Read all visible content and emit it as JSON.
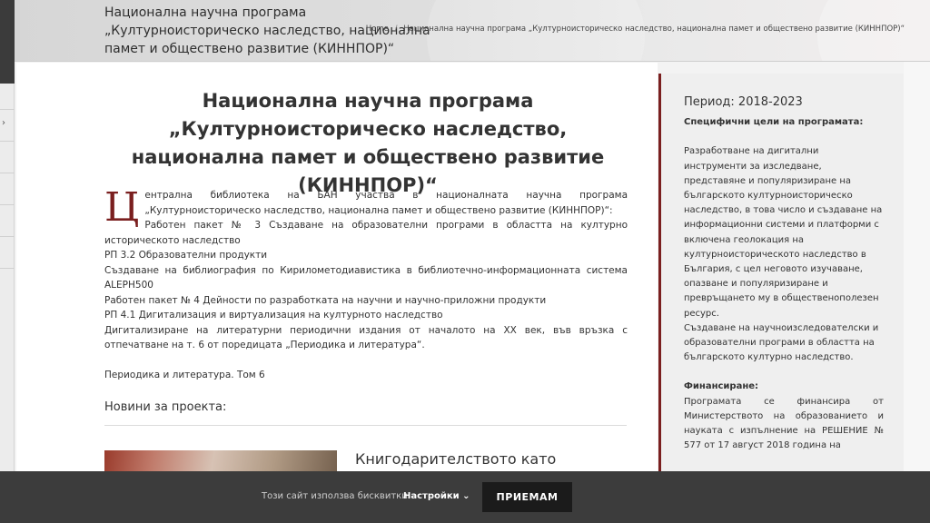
{
  "header": {
    "title": "Национална научна програма „Културноисторическо наследство, национална памет и обществено развитие (КИННПОР)“",
    "breadcrumb": {
      "home": "Home",
      "separator": "/",
      "current": "Национална научна програма „Културноисторическо наследство, национална памет и обществено развитие (КИННПОР)“"
    }
  },
  "left_strip": {
    "chevron_icon": "chevron-right-icon",
    "chevron_glyph": "›"
  },
  "article": {
    "title": "Национална научна програма „Културноисторическо наследство, национална памет и обществено развитие (КИННПОР)“",
    "dropcap": "Ц",
    "intro": "ентрална библиотека на БАН участва в националната научна програма „Културноисторическо наследство, национална памет и обществено развитие (КИННПОР)“:",
    "paragraphs": [
      "Работен пакет № 3 Създаване на образователни програми в областта на културно историческото наследство",
      "РП 3.2 Образователни продукти",
      "Създаване на библиография по Кирилометодиавистика в библиотечно-информационната система ALEPH500",
      "Работен пакет № 4 Дейности по разработката на научни и научно-приложни продукти",
      "РП 4.1 Дигитализация и виртуализация на културното наследство",
      "Дигитализиране на литературни периодични издания от началото на ХХ век, във връзка с отпечатване на т. 6 от поредицата „Периодика и литература“."
    ],
    "link": "Периодика и литература. Том 6"
  },
  "news": {
    "title": "Новини за проекта:",
    "item_title": "Книгодарителството като"
  },
  "sidebar": {
    "period": "Период: 2018-2023",
    "goals_heading": "Специфични цели на програмата:",
    "goals_text_1": "Разработване на дигитални инструменти за изследване, представяне и популяризиране на българското културноисторическо наследство, в това число и създаване на информационни системи и платформи с включена геолокация на културноисторическото наследство в България, с цел неговото изучаване, опазване и популяризиране и превръщането му в общественополезен ресурс.",
    "goals_text_2": "Създаване на научноизследователски и образователни програми в областта на българското културно наследство.",
    "funding_heading": "Финансиране:",
    "funding_text": "Програмата се финансира от Министерството на образованието и науката с изпълнение на РЕШЕНИЕ № 577 от 17 август 2018 година на"
  },
  "cookie": {
    "text": "Този сайт използва бисквитки!",
    "settings": "Настройки ⌄",
    "accept": "ПРИЕМАМ"
  },
  "colors": {
    "accent": "#7a1f1f",
    "cookie_bar": "#3c3c3c",
    "cookie_button": "#1b1b1b"
  }
}
